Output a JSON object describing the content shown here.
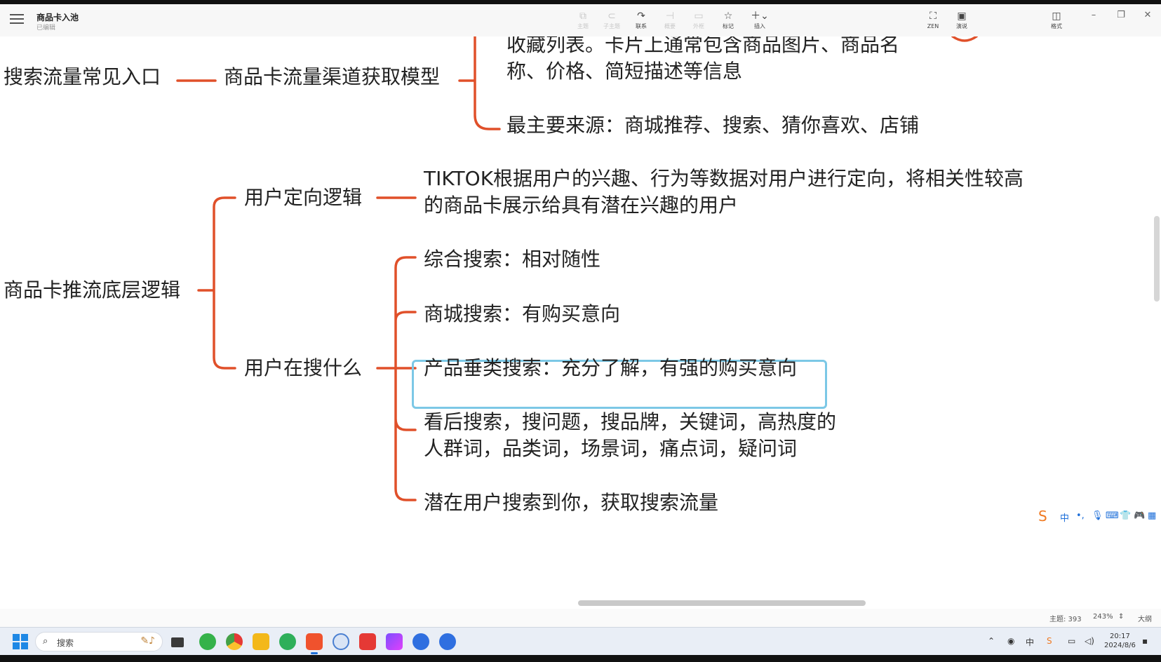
{
  "titlebar": {
    "doc_title": "商品卡入池",
    "doc_status": "已编辑",
    "tools": [
      {
        "label": "主题",
        "icon": "subtopic-icon"
      },
      {
        "label": "子主题",
        "icon": "child-topic-icon"
      },
      {
        "label": "联系",
        "icon": "relationship-icon"
      },
      {
        "label": "概要",
        "icon": "summary-icon"
      },
      {
        "label": "外框",
        "icon": "boundary-icon"
      },
      {
        "label": "标记",
        "icon": "star-icon"
      },
      {
        "label": "插入",
        "icon": "plus-icon"
      },
      {
        "label": "ZEN",
        "icon": "fullscreen-icon"
      },
      {
        "label": "演说",
        "icon": "present-icon"
      },
      {
        "label": "格式",
        "icon": "format-panel-icon"
      }
    ]
  },
  "mindmap": {
    "top": {
      "root": "搜索流量常见入口",
      "child": "商品卡流量渠道获取模型",
      "leaf1_line1": "收藏列表。卡片上通常包含商品图片、商品名",
      "leaf1_line2": "称、价格、简短描述等信息",
      "leaf2": "最主要来源：商城推荐、搜索、猜你喜欢、店铺"
    },
    "main": {
      "root": "商品卡推流底层逻辑",
      "branch1": "用户定向逻辑",
      "branch1_leaf_line1": "TIKTOK根据用户的兴趣、行为等数据对用户进行定向，将相关性较高",
      "branch1_leaf_line2": "的商品卡展示给具有潜在兴趣的用户",
      "branch2": "用户在搜什么",
      "leaves": [
        "综合搜索：相对随性",
        "商城搜索：有购买意向",
        "产品垂类搜索：充分了解，有强的购买意向",
        "看后搜索，搜问题，搜品牌，关键词，高热度的",
        "人群词，品类词，场景词，痛点词，疑问词",
        "潜在用户搜索到你，获取搜索流量"
      ]
    }
  },
  "statusbar": {
    "topic_count": "主题: 393",
    "zoom": "243%",
    "outline": "大纲"
  },
  "taskbar": {
    "search_label": "搜索",
    "time": "20:17",
    "date": "2024/8/6"
  },
  "ime": {
    "lang": "中"
  },
  "colors": {
    "branch_line": "#e0502a",
    "selection": "#7cc8e6"
  }
}
